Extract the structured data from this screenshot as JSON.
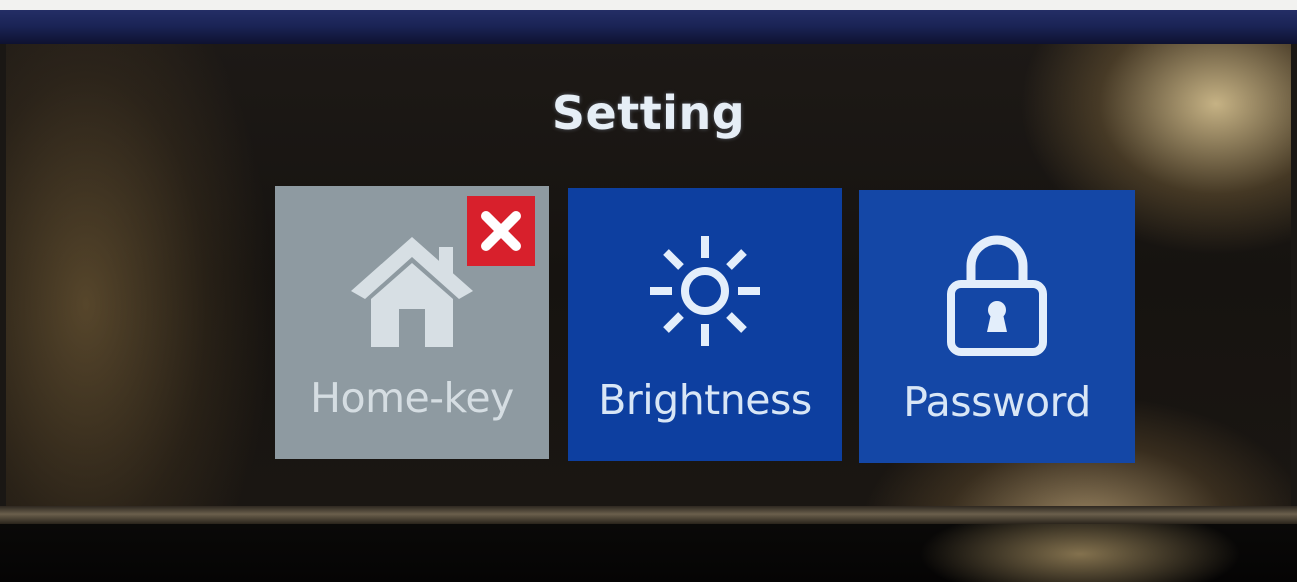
{
  "screen": {
    "title": "Setting"
  },
  "tiles": [
    {
      "label": "Home-key",
      "icon": "home-icon",
      "state": "disabled",
      "badge_icon": "close-icon",
      "color": "#8e9aa1"
    },
    {
      "label": "Brightness",
      "icon": "sun-icon",
      "state": "enabled",
      "color": "#0d3fa0"
    },
    {
      "label": "Password",
      "icon": "lock-icon",
      "state": "enabled",
      "color": "#1447a6"
    }
  ],
  "colors": {
    "accent_blue": "#0d3fa0",
    "disabled_gray": "#8e9aa1",
    "close_red": "#d8202c",
    "text_light": "#e6eef6"
  }
}
